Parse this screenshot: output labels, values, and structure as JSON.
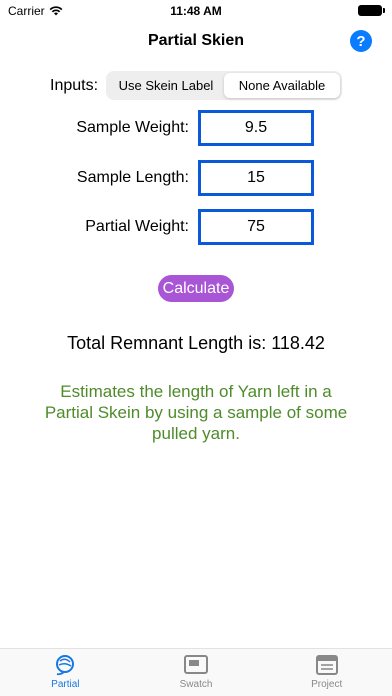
{
  "status": {
    "carrier": "Carrier",
    "time": "11:48 AM"
  },
  "nav": {
    "title": "Partial Skien",
    "help_symbol": "?"
  },
  "inputs": {
    "label": "Inputs:",
    "options": [
      "Use Skein Label",
      "None Available"
    ],
    "selected": "None Available"
  },
  "fields": [
    {
      "label": "Sample Weight:",
      "value": "9.5"
    },
    {
      "label": "Sample Length:",
      "value": "15"
    },
    {
      "label": "Partial Weight:",
      "value": "75"
    }
  ],
  "calculate_label": "Calculate",
  "result_text": "Total Remnant Length is: 118.42",
  "description": "Estimates the length of Yarn left in a Partial Skein by using a sample of some pulled yarn.",
  "tabs": [
    {
      "label": "Partial",
      "icon": "yarn-icon",
      "active": true
    },
    {
      "label": "Swatch",
      "icon": "swatch-icon",
      "active": false
    },
    {
      "label": "Project",
      "icon": "project-icon",
      "active": false
    }
  ],
  "colors": {
    "accent": "#0a7cff",
    "field_border": "#0a59d9",
    "button": "#a855d6",
    "description": "#4e8b2a",
    "tab_active": "#1877e0"
  }
}
